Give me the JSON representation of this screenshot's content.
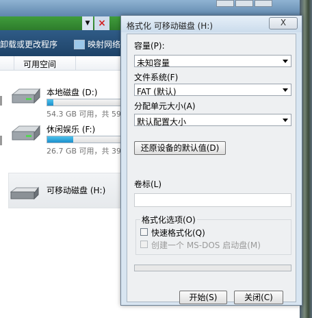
{
  "explorer": {
    "toolbar": {
      "uninstall_label": "卸载或更改程序",
      "map_network_label": "映射网络"
    },
    "column_header": {
      "free_space": "可用空间"
    },
    "drives": [
      {
        "name": "本地磁盘 (D:)",
        "info": "54.3 GB 可用，共 59.",
        "used_fraction": 0.08
      },
      {
        "name": "休闲娱乐 (F:)",
        "info": "26.7 GB 可用，共 39.",
        "used_fraction": 0.32
      },
      {
        "name": "可移动磁盘 (H:)"
      }
    ]
  },
  "dialog": {
    "title": "格式化 可移动磁盘 (H:)",
    "close_label": "X",
    "capacity": {
      "label": "容量(P):",
      "value": "未知容量"
    },
    "filesystem": {
      "label": "文件系统(F)",
      "value": "FAT (默认)"
    },
    "allocation": {
      "label": "分配单元大小(A)",
      "value": "默认配置大小"
    },
    "restore_defaults_label": "还原设备的默认值(D)",
    "volume": {
      "label": "卷标(L)",
      "value": ""
    },
    "options": {
      "title": "格式化选项(O)",
      "quick_format_label": "快速格式化(Q)",
      "quick_format_checked": false,
      "msdos_label": "创建一个 MS-DOS 启动盘(M)",
      "msdos_enabled": false
    },
    "progress_fraction": 0,
    "start_label": "开始(S)",
    "close_button_label": "关闭(C)"
  }
}
